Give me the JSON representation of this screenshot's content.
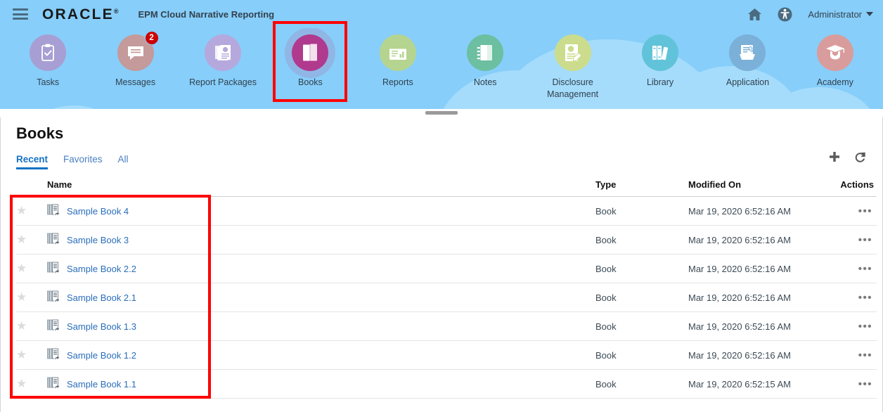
{
  "header": {
    "menu_icon": "hamburger-menu-icon",
    "brand": "ORACLE",
    "brand_reg": "®",
    "app_name": "EPM Cloud Narrative Reporting",
    "home_icon": "home-icon",
    "accessibility_icon": "accessibility-icon",
    "user": "Administrator"
  },
  "nav": {
    "items": [
      {
        "label": "Tasks",
        "icon": "clipboard-check-icon",
        "color": "#a79fd4",
        "selected": false,
        "badge": ""
      },
      {
        "label": "Messages",
        "icon": "speech-bubble-icon",
        "color": "#c49a9a",
        "selected": false,
        "badge": "2"
      },
      {
        "label": "Report Packages",
        "icon": "report-stack-icon",
        "color": "#b5a8dd",
        "selected": false,
        "badge": ""
      },
      {
        "label": "Books",
        "icon": "books-icon",
        "color": "#b03a8e",
        "selected": true,
        "badge": ""
      },
      {
        "label": "Reports",
        "icon": "report-page-icon",
        "color": "#b5d48f",
        "selected": false,
        "badge": ""
      },
      {
        "label": "Notes",
        "icon": "notebook-icon",
        "color": "#6cbfa0",
        "selected": false,
        "badge": ""
      },
      {
        "label": "Disclosure Management",
        "icon": "disclosure-tag-icon",
        "color": "#cbdc8c",
        "selected": false,
        "badge": ""
      },
      {
        "label": "Library",
        "icon": "library-books-icon",
        "color": "#61c3d9",
        "selected": false,
        "badge": ""
      },
      {
        "label": "Application",
        "icon": "application-gear-icon",
        "color": "#7bb0d8",
        "selected": false,
        "badge": ""
      },
      {
        "label": "Academy",
        "icon": "graduation-cap-icon",
        "color": "#d99c9c",
        "selected": false,
        "badge": ""
      }
    ]
  },
  "page": {
    "title": "Books",
    "tabs": [
      {
        "label": "Recent",
        "active": true
      },
      {
        "label": "Favorites",
        "active": false
      },
      {
        "label": "All",
        "active": false
      }
    ],
    "toolbar": [
      {
        "name": "add-button",
        "icon": "plus-icon"
      },
      {
        "name": "refresh-button",
        "icon": "refresh-icon"
      }
    ]
  },
  "table": {
    "columns": [
      "",
      "Name",
      "Type",
      "Modified On",
      "Actions"
    ],
    "actions_glyph": "•••",
    "star_glyph": "★",
    "rows": [
      {
        "favorite": false,
        "icon": "book-shortcut-icon",
        "name": "Sample Book 4",
        "type": "Book",
        "modified": "Mar 19, 2020 6:52:16 AM"
      },
      {
        "favorite": false,
        "icon": "book-shortcut-icon",
        "name": "Sample Book 3",
        "type": "Book",
        "modified": "Mar 19, 2020 6:52:16 AM"
      },
      {
        "favorite": false,
        "icon": "book-shortcut-icon",
        "name": "Sample Book 2.2",
        "type": "Book",
        "modified": "Mar 19, 2020 6:52:16 AM"
      },
      {
        "favorite": false,
        "icon": "book-shortcut-icon",
        "name": "Sample Book 2.1",
        "type": "Book",
        "modified": "Mar 19, 2020 6:52:16 AM"
      },
      {
        "favorite": false,
        "icon": "book-shortcut-icon",
        "name": "Sample Book 1.3",
        "type": "Book",
        "modified": "Mar 19, 2020 6:52:16 AM"
      },
      {
        "favorite": false,
        "icon": "book-shortcut-icon",
        "name": "Sample Book 1.2",
        "type": "Book",
        "modified": "Mar 19, 2020 6:52:16 AM"
      },
      {
        "favorite": false,
        "icon": "book-shortcut-icon",
        "name": "Sample Book 1.1",
        "type": "Book",
        "modified": "Mar 19, 2020 6:52:15 AM"
      }
    ]
  },
  "annotations": [
    {
      "name": "books-nav-highlight",
      "color": "#ff0000"
    },
    {
      "name": "book-rows-highlight",
      "color": "#ff0000"
    }
  ]
}
